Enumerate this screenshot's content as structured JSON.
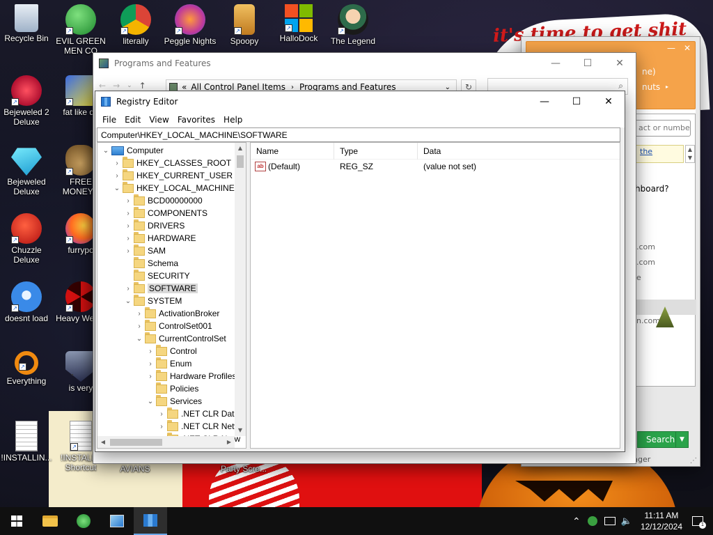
{
  "desktop_icons": [
    {
      "label": "Recycle Bin"
    },
    {
      "label": "EVIL GREEN MEN CO"
    },
    {
      "label": "literally"
    },
    {
      "label": "Peggle Nights"
    },
    {
      "label": "Spoopy"
    },
    {
      "label": "HalloDock"
    },
    {
      "label": "The Legend"
    },
    {
      "label": "Bejeweled 2 Deluxe"
    },
    {
      "label": "fat like da"
    },
    {
      "label": "Bejeweled Deluxe"
    },
    {
      "label": "FREE MONEY.e"
    },
    {
      "label": "Chuzzle Deluxe"
    },
    {
      "label": "furrypo"
    },
    {
      "label": "doesnt load"
    },
    {
      "label": "Heavy Weap."
    },
    {
      "label": "Everything"
    },
    {
      "label": "is very"
    },
    {
      "label": "!INSTALLIN..."
    },
    {
      "label": "!INSTALL - Shortcut"
    },
    {
      "label": "AVIANS"
    },
    {
      "label": "Party Scre..."
    }
  ],
  "wallpaper": {
    "text": "it's time to get shit"
  },
  "side_app": {
    "header_line1": "ne)",
    "header_line2": "nuts",
    "search_placeholder": "act or numbe",
    "link_text": "the",
    "question": "hboard?",
    "rows": [
      ".com",
      ".com",
      "e",
      "n.com"
    ],
    "search_button": "Search",
    "footer": "nger"
  },
  "programs_features": {
    "title": "Programs and Features",
    "breadcrumb": [
      "All Control Panel Items",
      "Programs and Features"
    ]
  },
  "registry": {
    "title": "Registry Editor",
    "menu": [
      "File",
      "Edit",
      "View",
      "Favorites",
      "Help"
    ],
    "path": "Computer\\HKEY_LOCAL_MACHINE\\SOFTWARE",
    "tree": [
      {
        "label": "Computer",
        "level": 0,
        "exp": "v",
        "type": "pc"
      },
      {
        "label": "HKEY_CLASSES_ROOT",
        "level": 1,
        "exp": ">"
      },
      {
        "label": "HKEY_CURRENT_USER",
        "level": 1,
        "exp": ">"
      },
      {
        "label": "HKEY_LOCAL_MACHINE",
        "level": 1,
        "exp": "v"
      },
      {
        "label": "BCD00000000",
        "level": 2,
        "exp": ">"
      },
      {
        "label": "COMPONENTS",
        "level": 2,
        "exp": ">"
      },
      {
        "label": "DRIVERS",
        "level": 2,
        "exp": ">"
      },
      {
        "label": "HARDWARE",
        "level": 2,
        "exp": ">"
      },
      {
        "label": "SAM",
        "level": 2,
        "exp": ">"
      },
      {
        "label": "Schema",
        "level": 2,
        "exp": ""
      },
      {
        "label": "SECURITY",
        "level": 2,
        "exp": ""
      },
      {
        "label": "SOFTWARE",
        "level": 2,
        "exp": ">",
        "selected": true
      },
      {
        "label": "SYSTEM",
        "level": 2,
        "exp": "v"
      },
      {
        "label": "ActivationBroker",
        "level": 3,
        "exp": ">"
      },
      {
        "label": "ControlSet001",
        "level": 3,
        "exp": ">"
      },
      {
        "label": "CurrentControlSet",
        "level": 3,
        "exp": "v"
      },
      {
        "label": "Control",
        "level": 4,
        "exp": ">"
      },
      {
        "label": "Enum",
        "level": 4,
        "exp": ">"
      },
      {
        "label": "Hardware Profiles",
        "level": 4,
        "exp": ">"
      },
      {
        "label": "Policies",
        "level": 4,
        "exp": ""
      },
      {
        "label": "Services",
        "level": 4,
        "exp": "v"
      },
      {
        "label": ".NET CLR Data",
        "level": 5,
        "exp": ">"
      },
      {
        "label": ".NET CLR Netw",
        "level": 5,
        "exp": ">"
      },
      {
        "label": ".NET CLR Netw",
        "level": 5,
        "exp": ">"
      }
    ],
    "columns": [
      "Name",
      "Type",
      "Data"
    ],
    "values": [
      {
        "name": "(Default)",
        "type": "REG_SZ",
        "data": "(value not set)"
      }
    ]
  },
  "taskbar": {
    "time": "11:11 AM",
    "date": "12/12/2024"
  }
}
